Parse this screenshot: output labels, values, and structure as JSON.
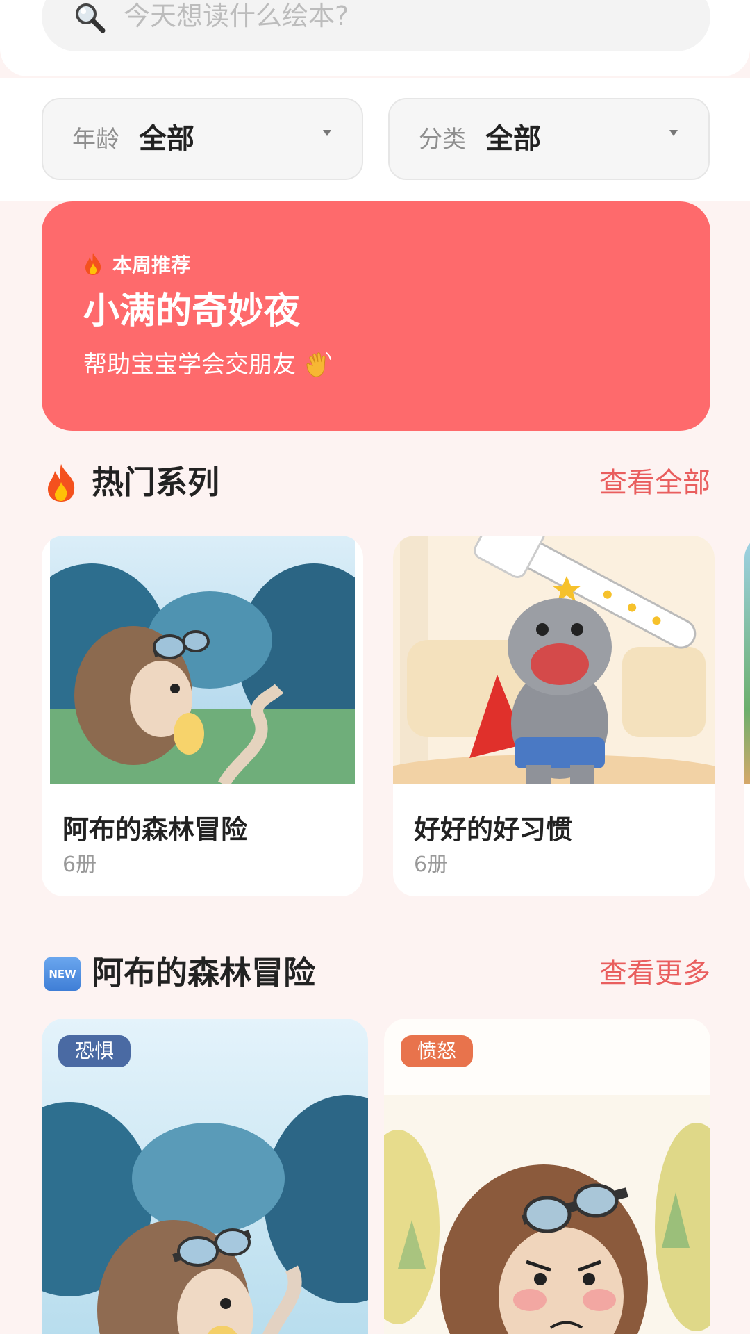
{
  "search": {
    "placeholder": "今天想读什么绘本?"
  },
  "filters": {
    "age": {
      "label": "年龄",
      "value": "全部"
    },
    "category": {
      "label": "分类",
      "value": "全部"
    }
  },
  "banner": {
    "tag": "本周推荐",
    "title": "小满的奇妙夜",
    "subtitle": "帮助宝宝学会交朋友",
    "tag_icon": "flame-icon",
    "subtitle_icon": "waving-hand-icon",
    "color": "#fe6a6c"
  },
  "hot_section": {
    "icon": "flame-icon",
    "title": "热门系列",
    "link": "查看全部",
    "cards": [
      {
        "name": "阿布的森林冒险",
        "count": "6册",
        "image": "hedgehog-in-forest"
      },
      {
        "name": "好好的好习惯",
        "count": "6册",
        "image": "hippo-with-toothbrush"
      }
    ]
  },
  "new_section": {
    "icon": "new-badge-icon",
    "badge": "NEW",
    "title": "阿布的森林冒险",
    "link": "查看更多",
    "books": [
      {
        "tag": "恐惧",
        "tag_color": "#4a6aa3",
        "image": "scared-hedgehog"
      },
      {
        "tag": "愤怒",
        "tag_color": "#e8734c",
        "image": "angry-hedgehog"
      }
    ]
  },
  "colors": {
    "accent": "#e95e5e",
    "background": "#fdf3f2"
  }
}
